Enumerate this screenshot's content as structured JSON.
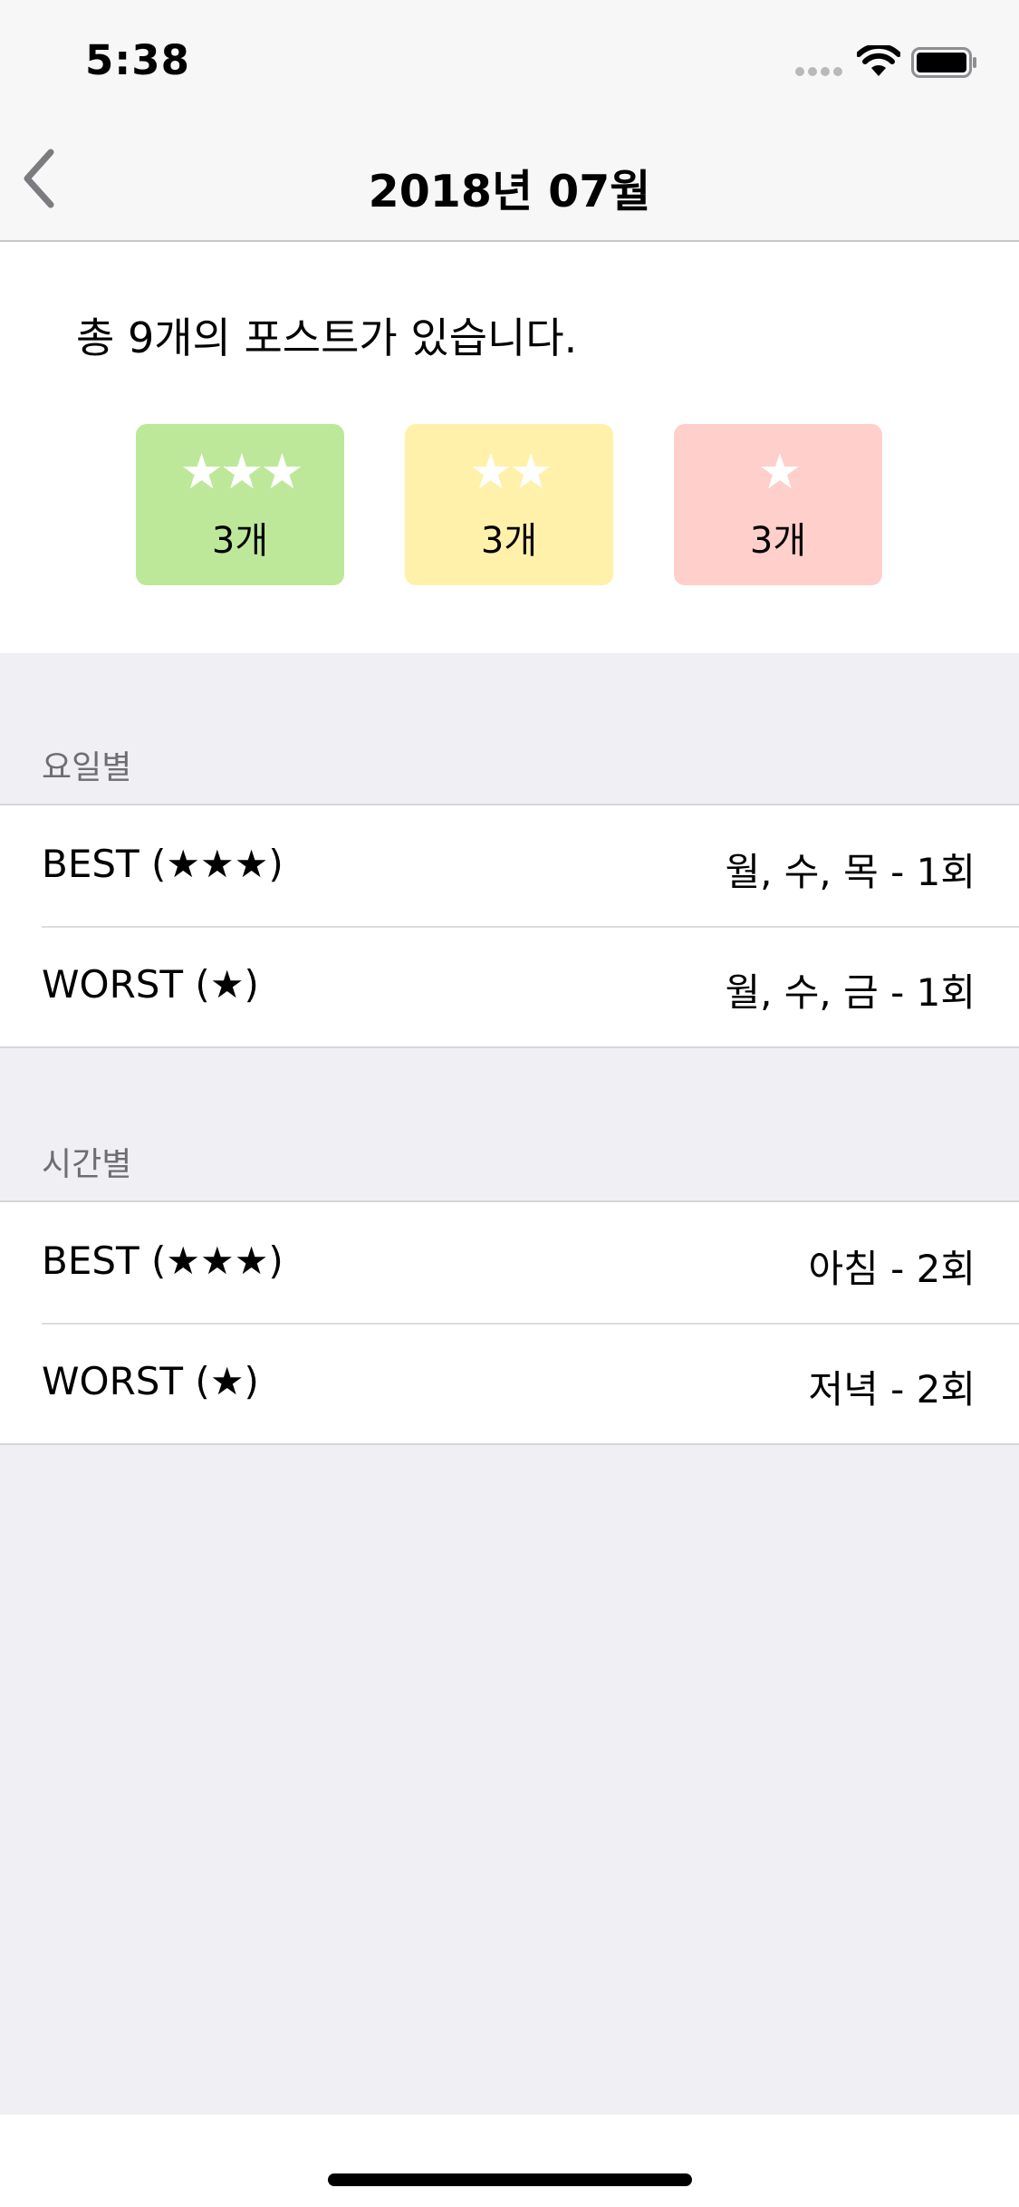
{
  "status_bar": {
    "time": "5:38",
    "icons": [
      "signal-dots-icon",
      "wifi-icon",
      "battery-icon"
    ]
  },
  "nav": {
    "title": "2018년 07월",
    "back_icon": "chevron-left-icon"
  },
  "summary": {
    "text": "총 9개의 포스트가 있습니다.",
    "ratings": [
      {
        "stars": "★★★",
        "count": "3개",
        "color": "#bde89a"
      },
      {
        "stars": "★★",
        "count": "3개",
        "color": "#fff1aa"
      },
      {
        "stars": "★",
        "count": "3개",
        "color": "#ffcfcb"
      }
    ]
  },
  "sections": [
    {
      "header": "요일별",
      "rows": [
        {
          "label": "BEST (★★★)",
          "value": "월, 수, 목 - 1회"
        },
        {
          "label": "WORST (★)",
          "value": "월, 수, 금 - 1회"
        }
      ]
    },
    {
      "header": "시간별",
      "rows": [
        {
          "label": "BEST (★★★)",
          "value": "아침 - 2회"
        },
        {
          "label": "WORST (★)",
          "value": "저녁 - 2회"
        }
      ]
    }
  ]
}
